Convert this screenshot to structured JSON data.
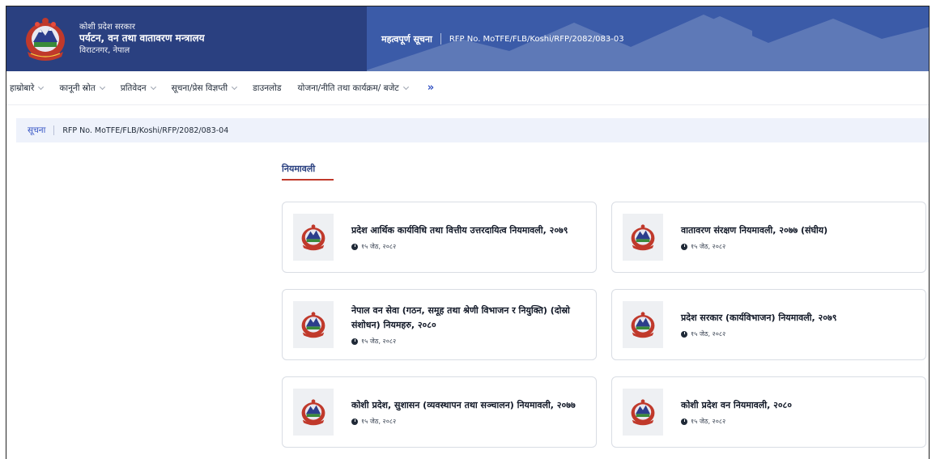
{
  "header": {
    "org_sub": "कोशी प्रदेश सरकार",
    "org_title": "पर्यटन, वन तथा वातावरण मन्त्रालय",
    "org_location": "विराटनगर, नेपाल",
    "notice_label": "महत्वपूर्ण सूचना",
    "notice_text": "RFP No. MoTFE/FLB/Koshi/RFP/2082/083-03"
  },
  "nav": {
    "items": [
      {
        "label": "हाम्रोबारे"
      },
      {
        "label": "कानूनी स्रोत"
      },
      {
        "label": "प्रतिवेदन"
      },
      {
        "label": "सूचना/प्रेस विज्ञप्ती"
      },
      {
        "label": "डाउनलोड"
      },
      {
        "label": "योजना/नीति तथा कार्यक्रम/ बजेट"
      }
    ],
    "more": "»"
  },
  "ticker": {
    "label": "सूचना",
    "text": "RFP No. MoTFE/FLB/Koshi/RFP/2082/083-04"
  },
  "section": {
    "title": "नियमावली"
  },
  "cards": [
    {
      "title": "प्रदेश आर्थिक कार्यविधि तथा वित्तीय उत्तरदायित्व नियमावली, २०७९",
      "date": "१५ जेठ, २०८२"
    },
    {
      "title": "वातावरण संरक्षण नियमावली, २०७७ (संघीय)",
      "date": "१५ जेठ, २०८२"
    },
    {
      "title": "नेपाल वन सेवा (गठन, समूह तथा श्रेणी विभाजन र नियुक्ति) (दोस्रो संशोधन) नियमहरु, २०८०",
      "date": "१५ जेठ, २०८२"
    },
    {
      "title": "प्रदेश सरकार (कार्यविभाजन) नियमावली, २०७९",
      "date": "१५ जेठ, २०८२"
    },
    {
      "title": "कोशी प्रदेश, सुशासन (व्यवस्थापन तथा सञ्चालन) नियमावली, २०७७",
      "date": "१५ जेठ, २०८२"
    },
    {
      "title": "कोशी प्रदेश वन नियमावली, २०८०",
      "date": "१५ जेठ, २०८२"
    }
  ],
  "colors": {
    "brand_dark": "#2a4080",
    "brand_light": "#3b5ba8",
    "accent_link": "#3554c4",
    "section_underline": "#c0392b",
    "ticker_bg": "#eef2fb"
  },
  "icons": {
    "emblem": "nepal-emblem-icon",
    "chevron": "chevron-down-icon",
    "more": "double-chevron-right-icon",
    "date": "clock-icon"
  }
}
